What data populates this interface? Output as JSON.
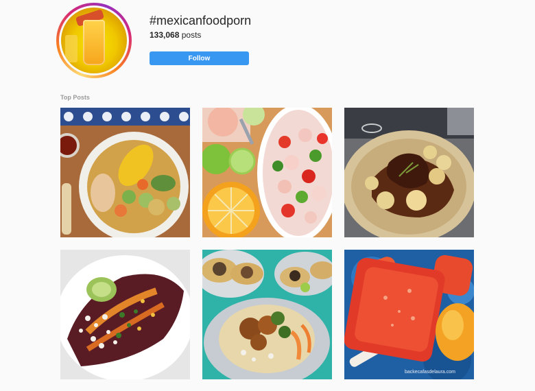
{
  "header": {
    "hashtag": "#mexicanfoodporn",
    "post_count": "133,068",
    "post_suffix": " posts",
    "follow_label": "Follow"
  },
  "section_title": "Top Posts",
  "colors": {
    "follow_blue": "#3897f0",
    "text": "#262626",
    "muted": "#999999",
    "background": "#fafafa"
  },
  "posts": [
    {
      "subject": "caldo de res soup with corn and vegetables"
    },
    {
      "subject": "shrimp ceviche with limes and orange"
    },
    {
      "subject": "braised meat with small potatoes"
    },
    {
      "subject": "enchiladas with cheese and avocado"
    },
    {
      "subject": "tacos on plates"
    },
    {
      "subject": "fruit popsicles with mango"
    }
  ],
  "watermark": "backecafasdelaura.com"
}
